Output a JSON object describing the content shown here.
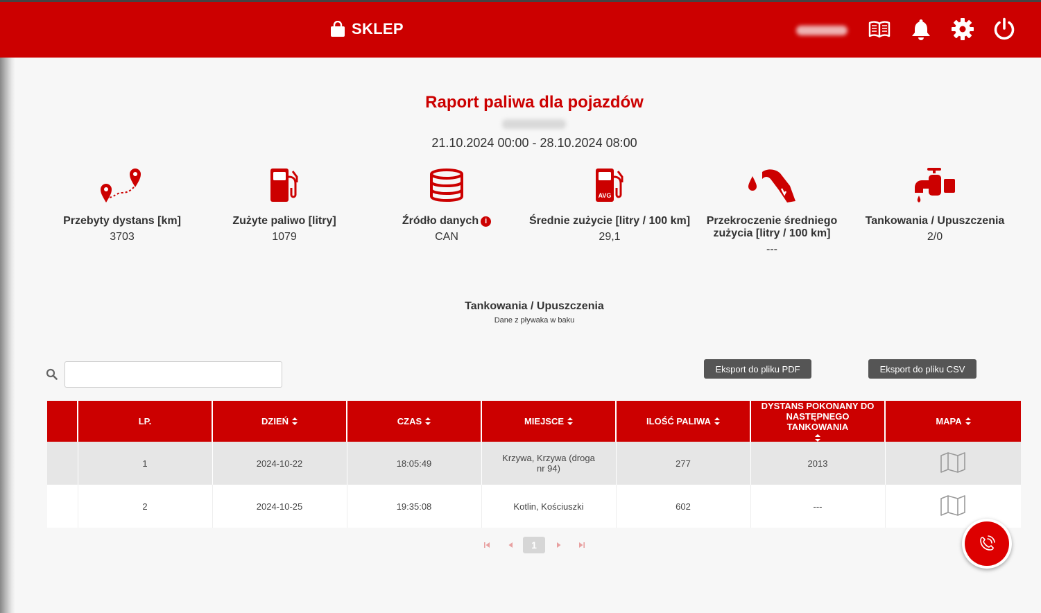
{
  "header": {
    "brand_label": "SKLEP",
    "icons": [
      "shopping-bag-icon",
      "book-icon",
      "bell-icon",
      "gear-icon",
      "power-icon"
    ]
  },
  "report": {
    "title": "Raport paliwa dla pojazdów",
    "date_range": "21.10.2024 00:00 - 28.10.2024 08:00"
  },
  "stats": [
    {
      "icon": "route-pins-icon",
      "label": "Przebyty dystans [km]",
      "value": "3703"
    },
    {
      "icon": "fuel-pump-icon",
      "label": "Zużyte paliwo [litry]",
      "value": "1079"
    },
    {
      "icon": "database-icon",
      "label": "Źródło danych",
      "value": "CAN"
    },
    {
      "icon": "fuel-pump-avg-icon",
      "label": "Średnie zużycie [litry / 100 km]",
      "value": "29,1"
    },
    {
      "icon": "fuel-nozzle-icon",
      "label": "Przekroczenie średniego zużycia [litry / 100 km]",
      "value": "---"
    },
    {
      "icon": "faucet-icon",
      "label": "Tankowania / Upuszczenia",
      "value": "2/0"
    }
  ],
  "section": {
    "title": "Tankowania / Upuszczenia",
    "subtitle": "Dane z pływaka w baku"
  },
  "toolbar": {
    "search_value": "",
    "export_pdf_label": "Eksport do pliku PDF",
    "export_csv_label": "Eksport do pliku CSV"
  },
  "table": {
    "headers": [
      "",
      "LP.",
      "DZIEŃ",
      "CZAS",
      "MIEJSCE",
      "ILOŚĆ PALIWA",
      "DYSTANS POKONANY DO NASTĘPNEGO TANKOWANIA",
      "MAPA"
    ],
    "rows": [
      {
        "lp": "1",
        "day": "2024-10-22",
        "time": "18:05:49",
        "place": "Krzywa, Krzywa (droga nr 94)",
        "fuel": "277",
        "distance": "2013",
        "map_icon": "map-icon"
      },
      {
        "lp": "2",
        "day": "2024-10-25",
        "time": "19:35:08",
        "place": "Kotlin, Kościuszki",
        "fuel": "602",
        "distance": "---",
        "map_icon": "map-icon"
      }
    ]
  },
  "pagination": {
    "current_page": "1",
    "icons": [
      "first-page-icon",
      "prev-page-icon",
      "next-page-icon",
      "last-page-icon"
    ]
  },
  "colors": {
    "brand_red": "#cc0000",
    "button_gray": "#555555",
    "row_stripe": "#e6e6e6"
  },
  "fab": {
    "icon": "phone-ringing-icon"
  }
}
